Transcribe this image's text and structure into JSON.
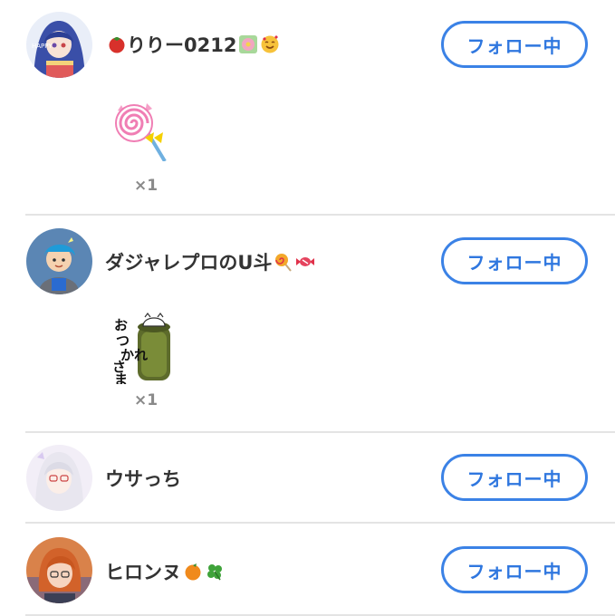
{
  "colors": {
    "accent": "#3b82e6",
    "divider": "#e4e4e4",
    "name_text": "#333333",
    "count_text": "#8a8a8a"
  },
  "users": [
    {
      "name": "りりー0212",
      "leading_emoji": "tomato-icon",
      "trailing_emojis": [
        "flower-icon",
        "smiling-face-with-hearts-icon"
      ],
      "follow_label": "フォロー中",
      "gift": {
        "icon": "lollipop-icon",
        "count": "×1"
      }
    },
    {
      "name": "ダジャレプロのU斗",
      "trailing_emojis": [
        "lollipop-icon",
        "candy-icon"
      ],
      "follow_label": "フォロー中",
      "gift": {
        "icon": "otsukare-sama-sticker-icon",
        "sticker_text": "おつかれさま",
        "count": "×1"
      }
    },
    {
      "name": "ウサっち",
      "trailing_emojis": [],
      "follow_label": "フォロー中"
    },
    {
      "name": "ヒロンヌ",
      "trailing_emojis": [
        "tangerine-icon",
        "four-leaf-clover-icon"
      ],
      "follow_label": "フォロー中"
    }
  ]
}
